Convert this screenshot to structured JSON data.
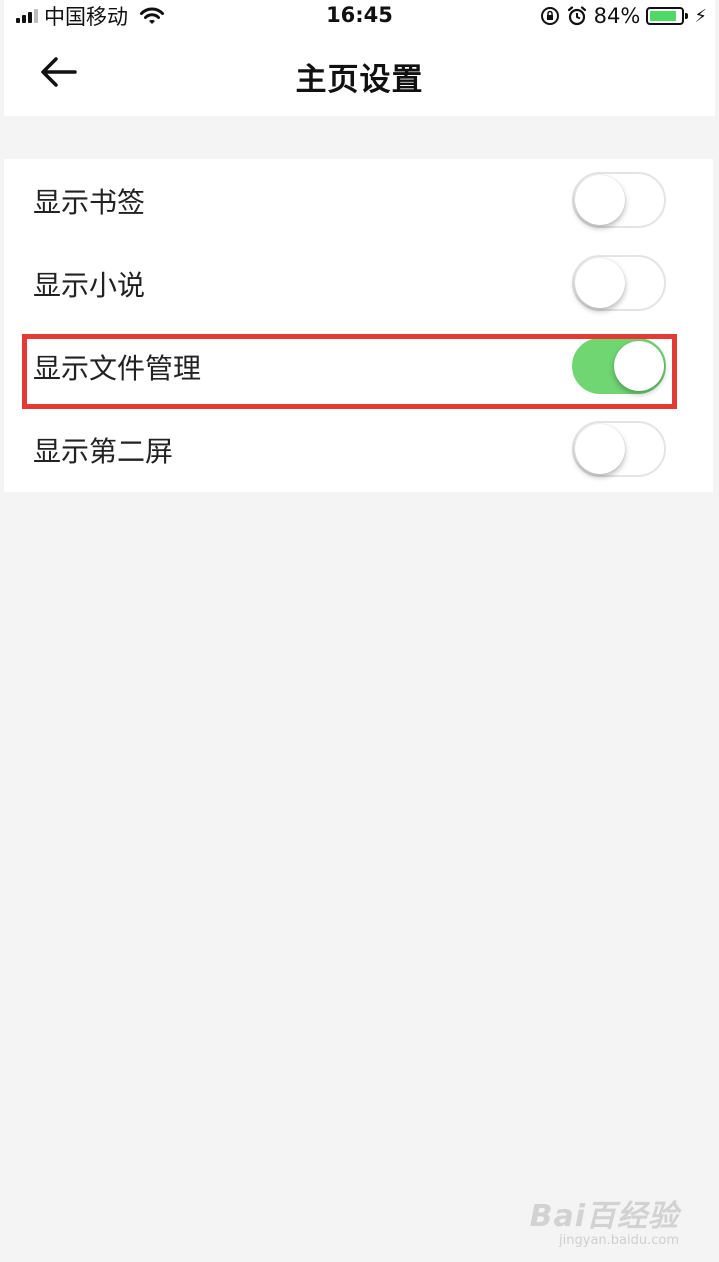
{
  "status_bar": {
    "carrier": "中国移动",
    "time": "16:45",
    "battery_percent": "84%",
    "battery_level": 0.84,
    "icons": [
      "signal-icon",
      "wifi-icon",
      "rotation-lock-icon",
      "alarm-icon",
      "battery-icon",
      "charging-icon"
    ]
  },
  "nav": {
    "title": "主页设置",
    "back_icon": "arrow-left-icon"
  },
  "settings": {
    "items": [
      {
        "label": "显示书签",
        "enabled": false
      },
      {
        "label": "显示小说",
        "enabled": false
      },
      {
        "label": "显示文件管理",
        "enabled": true
      },
      {
        "label": "显示第二屏",
        "enabled": false
      }
    ]
  },
  "colors": {
    "toggle_on": "#6fd672",
    "highlight": "#e53935",
    "background": "#f4f4f4"
  },
  "watermark": {
    "main": "Bai百经验",
    "sub": "jingyan.baidu.com"
  }
}
